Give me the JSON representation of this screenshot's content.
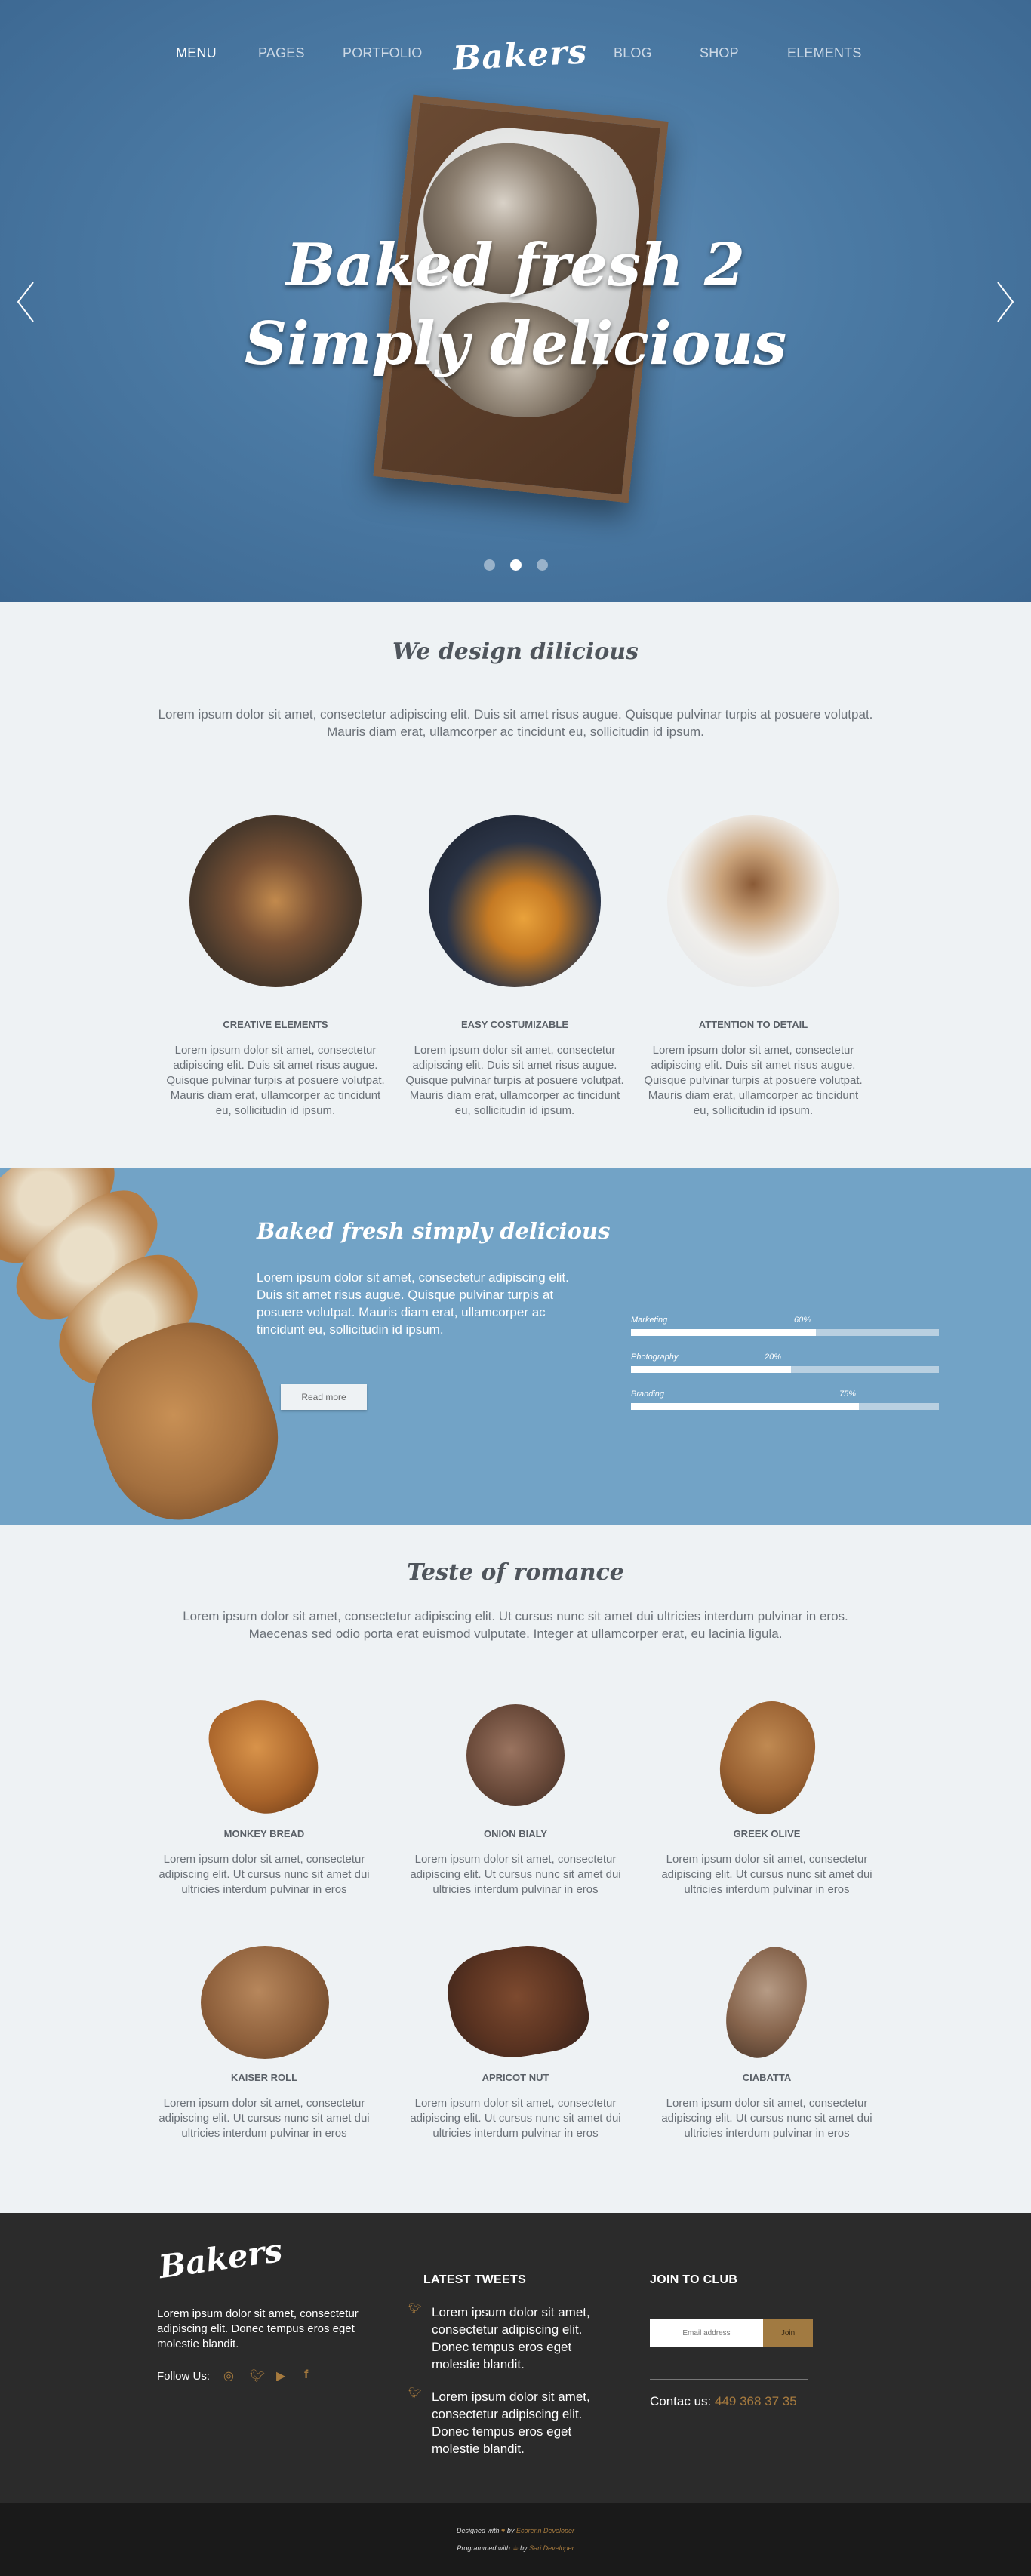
{
  "nav": {
    "left": [
      "MENU",
      "PAGES",
      "PORTFOLIO"
    ],
    "logo": "Bakers",
    "right": [
      "BLOG",
      "SHOP",
      "ELEMENTS"
    ]
  },
  "hero": {
    "line1": "Baked fresh 2",
    "line2": "Simply delicious",
    "slides_active_index": 1,
    "slides_count": 3,
    "prev_icon": "chevron-left-icon",
    "next_icon": "chevron-right-icon"
  },
  "intro": {
    "title": "We design dilicious",
    "text": "Lorem ipsum dolor sit amet, consectetur adipiscing elit. Duis sit amet risus augue. Quisque pulvinar turpis at posuere volutpat. Mauris diam erat, ullamcorper ac tincidunt eu, sollicitudin id ipsum.",
    "features": [
      {
        "title": "CREATIVE ELEMENTS",
        "text": "Lorem ipsum dolor sit amet, consectetur adipiscing elit. Duis sit amet risus augue. Quisque pulvinar turpis at posuere volutpat. Mauris diam erat, ullamcorper ac tincidunt eu, sollicitudin id ipsum."
      },
      {
        "title": "EASY COSTUMIZABLE",
        "text": "Lorem ipsum dolor sit amet, consectetur adipiscing elit. Duis sit amet risus augue. Quisque pulvinar turpis at posuere volutpat. Mauris diam erat, ullamcorper ac tincidunt eu, sollicitudin id ipsum."
      },
      {
        "title": "ATTENTION TO DETAIL",
        "text": "Lorem ipsum dolor sit amet, consectetur adipiscing elit. Duis sit amet risus augue. Quisque pulvinar turpis at posuere volutpat. Mauris diam erat, ullamcorper ac tincidunt eu, sollicitudin id ipsum."
      }
    ]
  },
  "band": {
    "title": "Baked fresh simply delicious",
    "text": "Lorem ipsum dolor sit amet, consectetur adipiscing elit. Duis sit amet risus augue. Quisque pulvinar turpis at posuere volutpat. Mauris diam erat, ullamcorper ac tincidunt eu, sollicitudin id ipsum.",
    "button": "Read more",
    "skills": [
      {
        "label": "Marketing",
        "percent_label": "60%",
        "value": 60
      },
      {
        "label": "Photography",
        "percent_label": "20%",
        "value": 52
      },
      {
        "label": "Branding",
        "percent_label": "75%",
        "value": 74
      }
    ]
  },
  "products": {
    "title": "Teste of romance",
    "text": "Lorem ipsum dolor sit amet, consectetur adipiscing elit. Ut cursus nunc sit amet dui ultricies interdum pulvinar in eros. Maecenas sed odio porta erat euismod vulputate. Integer at ullamcorper erat, eu lacinia ligula.",
    "items": [
      {
        "name": "MONKEY BREAD",
        "text": "Lorem ipsum dolor sit amet, consectetur adipiscing elit. Ut cursus nunc sit amet dui ultricies interdum pulvinar in eros"
      },
      {
        "name": "ONION BIALY",
        "text": "Lorem ipsum dolor sit amet, consectetur adipiscing elit. Ut cursus nunc sit amet dui ultricies interdum pulvinar in eros"
      },
      {
        "name": "GREEK OLIVE",
        "text": "Lorem ipsum dolor sit amet, consectetur adipiscing elit. Ut cursus nunc sit amet dui ultricies interdum pulvinar in eros"
      },
      {
        "name": "KAISER ROLL",
        "text": "Lorem ipsum dolor sit amet, consectetur adipiscing elit. Ut cursus nunc sit amet dui ultricies interdum pulvinar in eros"
      },
      {
        "name": "APRICOT NUT",
        "text": "Lorem ipsum dolor sit amet, consectetur adipiscing elit. Ut cursus nunc sit amet dui ultricies interdum pulvinar in eros"
      },
      {
        "name": "CIABATTA",
        "text": "Lorem ipsum dolor sit amet, consectetur adipiscing elit. Ut cursus nunc sit amet dui ultricies interdum pulvinar in eros"
      }
    ]
  },
  "footer": {
    "logo": "Bakers",
    "about": "Lorem ipsum dolor sit amet, consectetur adipiscing elit. Donec tempus eros eget molestie blandit.",
    "follow_label": "Follow Us:",
    "social_icons": [
      "instagram-icon",
      "twitter-icon",
      "youtube-icon",
      "facebook-icon"
    ],
    "tweets_heading": "LATEST TWEETS",
    "tweets": [
      "Lorem ipsum dolor sit amet, consectetur adipiscing elit. Donec tempus eros eget molestie blandit.",
      "Lorem ipsum dolor sit amet, consectetur adipiscing elit. Donec tempus eros eget molestie blandit."
    ],
    "club_heading": "JOIN TO CLUB",
    "email_placeholder": "Email address",
    "join_label": "Join",
    "contact_label": "Contac us:",
    "phone": "449 368 37 35"
  },
  "credits": {
    "designed_label": "Designed with",
    "by_label": "by",
    "designer": "Ecorenn Developer",
    "programmed_label": "Programmed with",
    "programmer": "Sari Developer"
  },
  "colors": {
    "hero_blue": "#4b7aa4",
    "band_blue": "#72a3c6",
    "accent_gold": "#a67a3e",
    "footer_dark": "#2b2b2b",
    "page_bg": "#eef2f4"
  }
}
